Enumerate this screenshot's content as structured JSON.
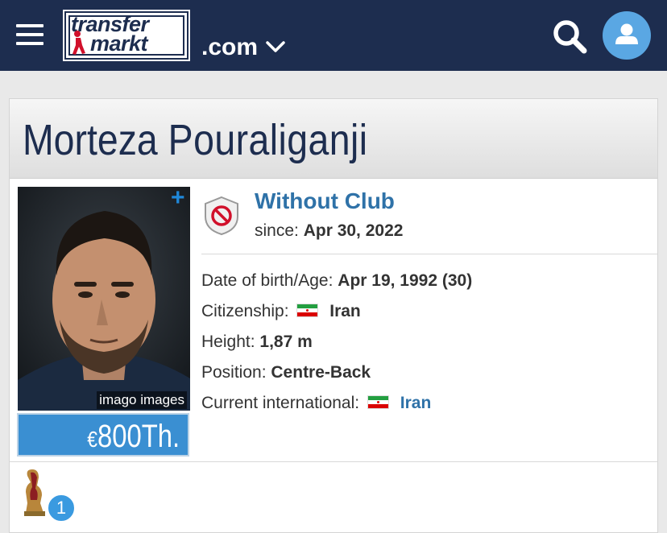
{
  "header": {
    "logo_line1": "transfer",
    "logo_line2": "markt",
    "domain": ".com",
    "icons": {
      "menu": "hamburger-icon",
      "search": "search-icon",
      "user": "user-icon",
      "dropdown": "chevron-down-icon"
    }
  },
  "player": {
    "first_name": "Morteza",
    "last_name": "Pouraliganji",
    "photo_credit": "imago images",
    "market_value_currency": "€",
    "market_value": "800Th.",
    "club": {
      "name": "Without Club",
      "since_label": "since:",
      "since_date": "Apr 30, 2022"
    },
    "details": {
      "dob_label": "Date of birth/Age:",
      "dob_value": "Apr 19, 1992 (30)",
      "citizenship_label": "Citizenship:",
      "citizenship_value": "Iran",
      "height_label": "Height:",
      "height_value": "1,87 m",
      "position_label": "Position:",
      "position_value": "Centre-Back",
      "international_label": "Current international:",
      "international_value": "Iran"
    },
    "trophies": {
      "count": "1"
    }
  },
  "colors": {
    "header_bg": "#1d2d4f",
    "accent_blue": "#2f72a8",
    "value_bg": "#3a8fd2",
    "user_btn": "#5aa7e3"
  }
}
